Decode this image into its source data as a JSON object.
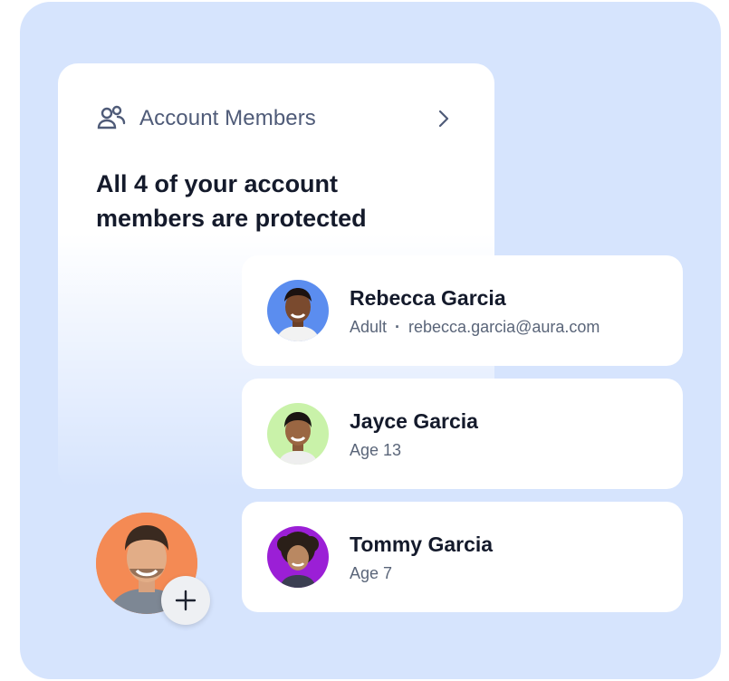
{
  "card": {
    "title": "Account Members",
    "headline": "All 4 of your account members are protected"
  },
  "members": [
    {
      "name": "Rebecca Garcia",
      "role": "Adult",
      "separator": "·",
      "email": "rebecca.garcia@aura.com",
      "avatar_bg": "#5b8def"
    },
    {
      "name": "Jayce Garcia",
      "detail": "Age 13",
      "avatar_bg": "#c9f2a9"
    },
    {
      "name": "Tommy Garcia",
      "detail": "Age 7",
      "avatar_bg": "#9b1fd6"
    }
  ],
  "add_member": {
    "avatar_bg": "#f48a54",
    "button_icon": "plus-icon"
  },
  "colors": {
    "panel": "#d6e4fd",
    "title_text": "#4f5b78",
    "headline_text": "#141a2b",
    "secondary_text": "#5a6579"
  },
  "icons": [
    "people-icon",
    "chevron-right-icon",
    "plus-icon"
  ]
}
